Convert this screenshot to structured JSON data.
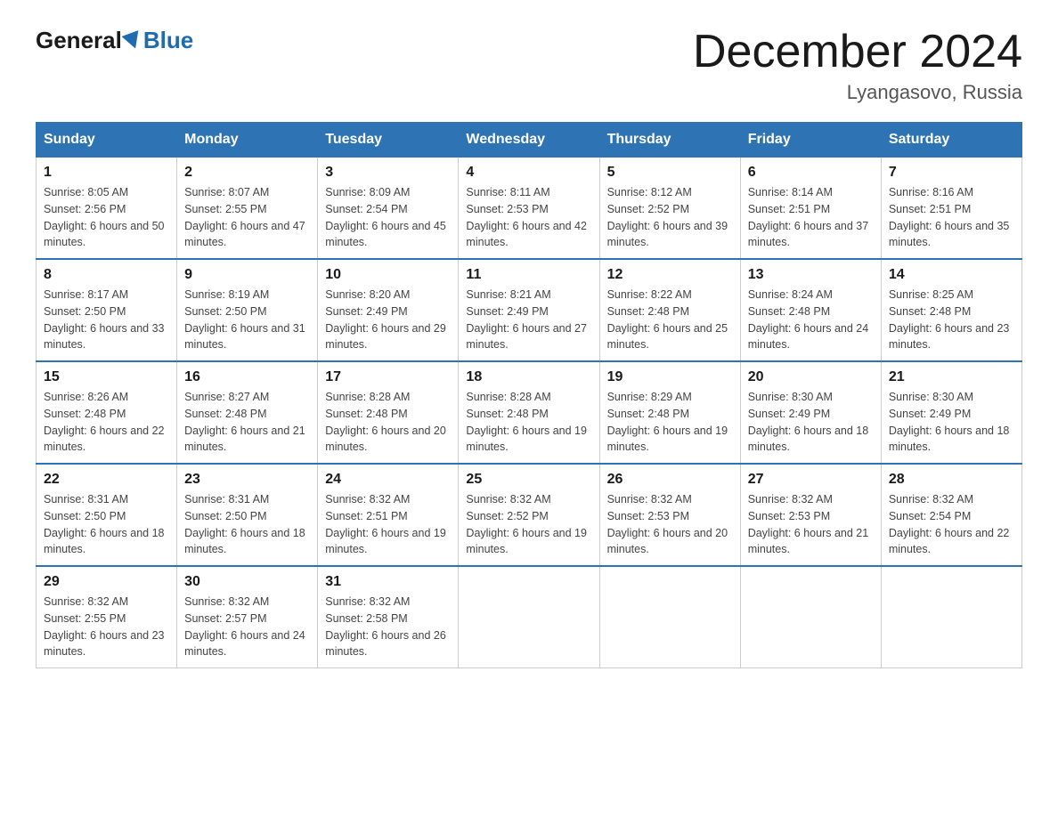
{
  "header": {
    "logo": {
      "general": "General",
      "triangle": "",
      "blue": "Blue"
    },
    "title": "December 2024",
    "location": "Lyangasovo, Russia"
  },
  "days_of_week": [
    "Sunday",
    "Monday",
    "Tuesday",
    "Wednesday",
    "Thursday",
    "Friday",
    "Saturday"
  ],
  "weeks": [
    [
      {
        "day": "1",
        "sunrise": "8:05 AM",
        "sunset": "2:56 PM",
        "daylight": "6 hours and 50 minutes."
      },
      {
        "day": "2",
        "sunrise": "8:07 AM",
        "sunset": "2:55 PM",
        "daylight": "6 hours and 47 minutes."
      },
      {
        "day": "3",
        "sunrise": "8:09 AM",
        "sunset": "2:54 PM",
        "daylight": "6 hours and 45 minutes."
      },
      {
        "day": "4",
        "sunrise": "8:11 AM",
        "sunset": "2:53 PM",
        "daylight": "6 hours and 42 minutes."
      },
      {
        "day": "5",
        "sunrise": "8:12 AM",
        "sunset": "2:52 PM",
        "daylight": "6 hours and 39 minutes."
      },
      {
        "day": "6",
        "sunrise": "8:14 AM",
        "sunset": "2:51 PM",
        "daylight": "6 hours and 37 minutes."
      },
      {
        "day": "7",
        "sunrise": "8:16 AM",
        "sunset": "2:51 PM",
        "daylight": "6 hours and 35 minutes."
      }
    ],
    [
      {
        "day": "8",
        "sunrise": "8:17 AM",
        "sunset": "2:50 PM",
        "daylight": "6 hours and 33 minutes."
      },
      {
        "day": "9",
        "sunrise": "8:19 AM",
        "sunset": "2:50 PM",
        "daylight": "6 hours and 31 minutes."
      },
      {
        "day": "10",
        "sunrise": "8:20 AM",
        "sunset": "2:49 PM",
        "daylight": "6 hours and 29 minutes."
      },
      {
        "day": "11",
        "sunrise": "8:21 AM",
        "sunset": "2:49 PM",
        "daylight": "6 hours and 27 minutes."
      },
      {
        "day": "12",
        "sunrise": "8:22 AM",
        "sunset": "2:48 PM",
        "daylight": "6 hours and 25 minutes."
      },
      {
        "day": "13",
        "sunrise": "8:24 AM",
        "sunset": "2:48 PM",
        "daylight": "6 hours and 24 minutes."
      },
      {
        "day": "14",
        "sunrise": "8:25 AM",
        "sunset": "2:48 PM",
        "daylight": "6 hours and 23 minutes."
      }
    ],
    [
      {
        "day": "15",
        "sunrise": "8:26 AM",
        "sunset": "2:48 PM",
        "daylight": "6 hours and 22 minutes."
      },
      {
        "day": "16",
        "sunrise": "8:27 AM",
        "sunset": "2:48 PM",
        "daylight": "6 hours and 21 minutes."
      },
      {
        "day": "17",
        "sunrise": "8:28 AM",
        "sunset": "2:48 PM",
        "daylight": "6 hours and 20 minutes."
      },
      {
        "day": "18",
        "sunrise": "8:28 AM",
        "sunset": "2:48 PM",
        "daylight": "6 hours and 19 minutes."
      },
      {
        "day": "19",
        "sunrise": "8:29 AM",
        "sunset": "2:48 PM",
        "daylight": "6 hours and 19 minutes."
      },
      {
        "day": "20",
        "sunrise": "8:30 AM",
        "sunset": "2:49 PM",
        "daylight": "6 hours and 18 minutes."
      },
      {
        "day": "21",
        "sunrise": "8:30 AM",
        "sunset": "2:49 PM",
        "daylight": "6 hours and 18 minutes."
      }
    ],
    [
      {
        "day": "22",
        "sunrise": "8:31 AM",
        "sunset": "2:50 PM",
        "daylight": "6 hours and 18 minutes."
      },
      {
        "day": "23",
        "sunrise": "8:31 AM",
        "sunset": "2:50 PM",
        "daylight": "6 hours and 18 minutes."
      },
      {
        "day": "24",
        "sunrise": "8:32 AM",
        "sunset": "2:51 PM",
        "daylight": "6 hours and 19 minutes."
      },
      {
        "day": "25",
        "sunrise": "8:32 AM",
        "sunset": "2:52 PM",
        "daylight": "6 hours and 19 minutes."
      },
      {
        "day": "26",
        "sunrise": "8:32 AM",
        "sunset": "2:53 PM",
        "daylight": "6 hours and 20 minutes."
      },
      {
        "day": "27",
        "sunrise": "8:32 AM",
        "sunset": "2:53 PM",
        "daylight": "6 hours and 21 minutes."
      },
      {
        "day": "28",
        "sunrise": "8:32 AM",
        "sunset": "2:54 PM",
        "daylight": "6 hours and 22 minutes."
      }
    ],
    [
      {
        "day": "29",
        "sunrise": "8:32 AM",
        "sunset": "2:55 PM",
        "daylight": "6 hours and 23 minutes."
      },
      {
        "day": "30",
        "sunrise": "8:32 AM",
        "sunset": "2:57 PM",
        "daylight": "6 hours and 24 minutes."
      },
      {
        "day": "31",
        "sunrise": "8:32 AM",
        "sunset": "2:58 PM",
        "daylight": "6 hours and 26 minutes."
      },
      null,
      null,
      null,
      null
    ]
  ],
  "colors": {
    "header_bg": "#2e74b5",
    "header_text": "#ffffff",
    "border": "#cccccc",
    "accent": "#1e6bb0"
  }
}
